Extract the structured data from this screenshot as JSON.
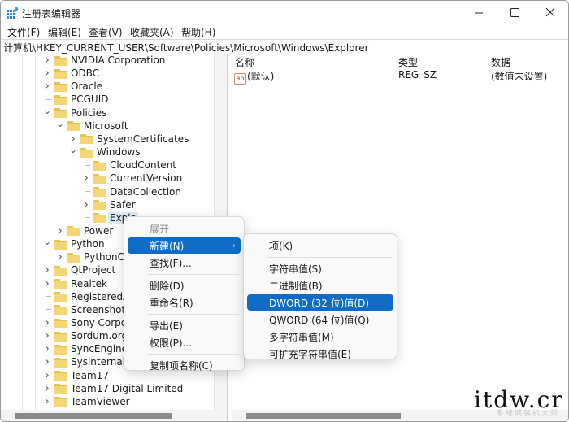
{
  "window": {
    "title": "注册表编辑器",
    "controls": {
      "minimize": "—",
      "maximize": "☐",
      "close": "✕"
    }
  },
  "menubar": {
    "items": [
      {
        "label": "文件(F)"
      },
      {
        "label": "编辑(E)"
      },
      {
        "label": "查看(V)"
      },
      {
        "label": "收藏夹(A)"
      },
      {
        "label": "帮助(H)"
      }
    ]
  },
  "address": "计算机\\HKEY_CURRENT_USER\\Software\\Policies\\Microsoft\\Windows\\Explorer",
  "tree": {
    "nodes": [
      {
        "label": "NVIDIA Corporation",
        "level": 0,
        "state": "collapsed"
      },
      {
        "label": "ODBC",
        "level": 0,
        "state": "collapsed"
      },
      {
        "label": "Oracle",
        "level": 0,
        "state": "collapsed"
      },
      {
        "label": "PCGUID",
        "level": 0,
        "state": "leaf"
      },
      {
        "label": "Policies",
        "level": 0,
        "state": "expanded"
      },
      {
        "label": "Microsoft",
        "level": 1,
        "state": "expanded"
      },
      {
        "label": "SystemCertificates",
        "level": 2,
        "state": "collapsed"
      },
      {
        "label": "Windows",
        "level": 2,
        "state": "expanded"
      },
      {
        "label": "CloudContent",
        "level": 3,
        "state": "leaf"
      },
      {
        "label": "CurrentVersion",
        "level": 3,
        "state": "collapsed"
      },
      {
        "label": "DataCollection",
        "level": 3,
        "state": "leaf"
      },
      {
        "label": "Safer",
        "level": 3,
        "state": "collapsed"
      },
      {
        "label": "Explo",
        "level": 3,
        "state": "leaf",
        "selected": true
      },
      {
        "label": "Power",
        "level": 1,
        "state": "collapsed"
      },
      {
        "label": "Python",
        "level": 0,
        "state": "expanded"
      },
      {
        "label": "PythonCo",
        "level": 1,
        "state": "collapsed"
      },
      {
        "label": "QtProject",
        "level": 0,
        "state": "collapsed"
      },
      {
        "label": "Realtek",
        "level": 0,
        "state": "collapsed"
      },
      {
        "label": "RegisteredAp",
        "level": 0,
        "state": "leaf"
      },
      {
        "label": "Screenshot S",
        "level": 0,
        "state": "leaf"
      },
      {
        "label": "Sony Corpor",
        "level": 0,
        "state": "collapsed"
      },
      {
        "label": "Sordum.org",
        "level": 0,
        "state": "collapsed"
      },
      {
        "label": "SyncEngines",
        "level": 0,
        "state": "collapsed"
      },
      {
        "label": "Sysinternals",
        "level": 0,
        "state": "collapsed"
      },
      {
        "label": "Team17",
        "level": 0,
        "state": "collapsed"
      },
      {
        "label": "Team17 Digital Limited",
        "level": 0,
        "state": "collapsed"
      },
      {
        "label": "TeamViewer",
        "level": 0,
        "state": "collapsed"
      }
    ]
  },
  "list": {
    "columns": [
      "名称",
      "类型",
      "数据"
    ],
    "rows": [
      {
        "icon": "ab",
        "name": "(默认)",
        "type": "REG_SZ",
        "data": "(数值未设置)"
      }
    ]
  },
  "context_menu": {
    "items": [
      {
        "label": "展开",
        "disabled": true
      },
      {
        "label": "新建(N)",
        "highlighted": true,
        "submenu": true
      },
      {
        "label": "查找(F)..."
      },
      {
        "separator": true
      },
      {
        "label": "删除(D)"
      },
      {
        "label": "重命名(R)"
      },
      {
        "separator": true
      },
      {
        "label": "导出(E)"
      },
      {
        "label": "权限(P)..."
      },
      {
        "separator": true
      },
      {
        "label": "复制项名称(C)"
      }
    ]
  },
  "submenu": {
    "items": [
      {
        "label": "项(K)"
      },
      {
        "separator": true
      },
      {
        "label": "字符串值(S)"
      },
      {
        "label": "二进制值(B)"
      },
      {
        "label": "DWORD (32 位)值(D)",
        "highlighted": true
      },
      {
        "label": "QWORD (64 位)值(Q)"
      },
      {
        "label": "多字符串值(M)"
      },
      {
        "label": "可扩充字符串值(E)"
      }
    ]
  },
  "watermark": {
    "text": "itdw.cr",
    "sub": "系统城装机大师"
  },
  "colors": {
    "highlight": "#0f6cc4",
    "selection": "#dceaf8",
    "folder": "#f4d676"
  }
}
